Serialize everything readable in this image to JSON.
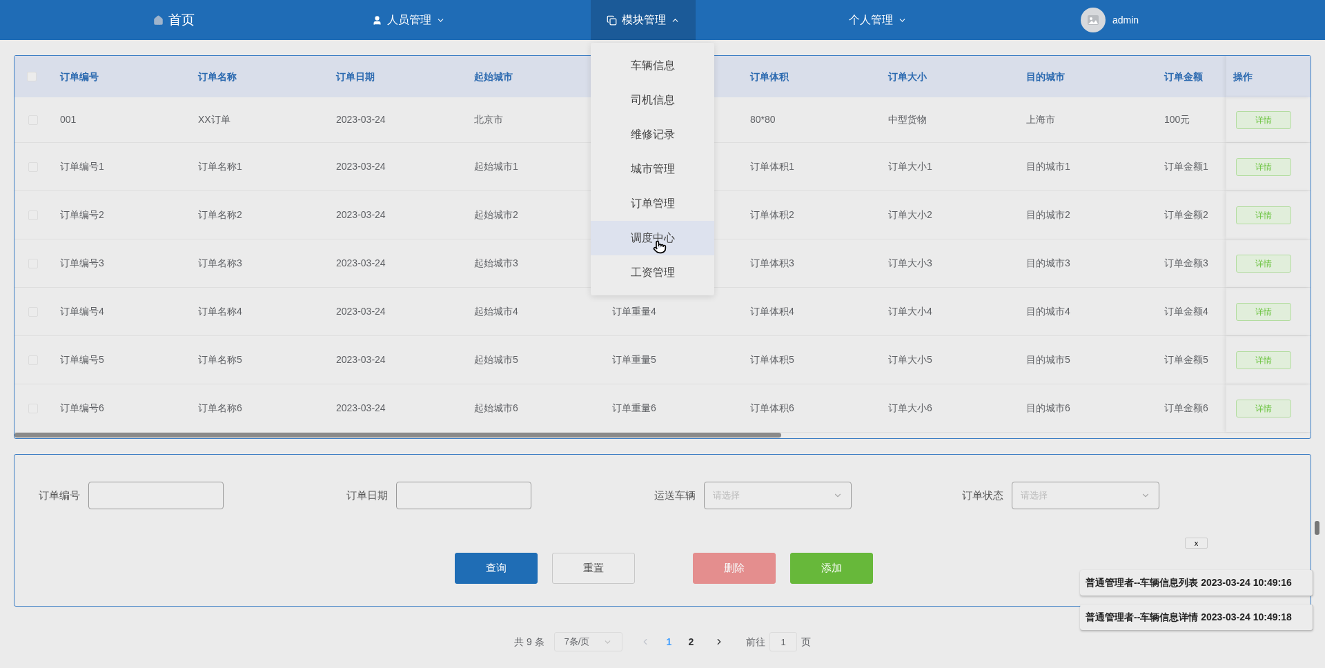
{
  "nav": {
    "items": [
      {
        "kind": "home",
        "label": "首页",
        "selected": false
      },
      {
        "kind": "people",
        "label": "人员管理",
        "expanded": false,
        "selected": false
      },
      {
        "kind": "modules",
        "label": "模块管理",
        "expanded": true,
        "selected": true,
        "menu": [
          {
            "label": "车辆信息",
            "selected": false
          },
          {
            "label": "司机信息",
            "selected": false
          },
          {
            "label": "维修记录",
            "selected": false
          },
          {
            "label": "城市管理",
            "selected": false
          },
          {
            "label": "订单管理",
            "selected": false
          },
          {
            "label": "调度中心",
            "selected": true
          },
          {
            "label": "工资管理",
            "selected": false
          }
        ]
      },
      {
        "kind": "personal",
        "label": "个人管理",
        "expanded": false,
        "selected": false
      }
    ],
    "user": {
      "name": "admin"
    }
  },
  "table": {
    "select_all_checked": false,
    "columns": [
      "订单编号",
      "订单名称",
      "订单日期",
      "起始城市",
      null,
      "订单体积",
      "订单大小",
      "目的城市",
      "订单金额"
    ],
    "action_heading": "操作",
    "rows": [
      {
        "checked": false,
        "cells": [
          "001",
          "XX订单",
          "2023-03-24",
          "北京市",
          null,
          "80*80",
          "中型货物",
          "上海市",
          "100元"
        ],
        "action": "详情"
      },
      {
        "checked": false,
        "cells": [
          "订单编号1",
          "订单名称1",
          "2023-03-24",
          "起始城市1",
          null,
          "订单体积1",
          "订单大小1",
          "目的城市1",
          "订单金额1"
        ],
        "action": "详情"
      },
      {
        "checked": false,
        "cells": [
          "订单编号2",
          "订单名称2",
          "2023-03-24",
          "起始城市2",
          null,
          "订单体积2",
          "订单大小2",
          "目的城市2",
          "订单金额2"
        ],
        "action": "详情"
      },
      {
        "checked": false,
        "cells": [
          "订单编号3",
          "订单名称3",
          "2023-03-24",
          "起始城市3",
          null,
          "订单体积3",
          "订单大小3",
          "目的城市3",
          "订单金额3"
        ],
        "action": "详情"
      },
      {
        "checked": false,
        "cells": [
          "订单编号4",
          "订单名称4",
          "2023-03-24",
          "起始城市4",
          "订单重量4",
          "订单体积4",
          "订单大小4",
          "目的城市4",
          "订单金额4"
        ],
        "action": "详情"
      },
      {
        "checked": false,
        "cells": [
          "订单编号5",
          "订单名称5",
          "2023-03-24",
          "起始城市5",
          "订单重量5",
          "订单体积5",
          "订单大小5",
          "目的城市5",
          "订单金额5"
        ],
        "action": "详情"
      },
      {
        "checked": false,
        "cells": [
          "订单编号6",
          "订单名称6",
          "2023-03-24",
          "起始城市6",
          "订单重量6",
          "订单体积6",
          "订单大小6",
          "目的城市6",
          "订单金额6"
        ],
        "action": "详情"
      }
    ]
  },
  "search_form": {
    "fields": [
      {
        "kind": "text",
        "label": "订单编号"
      },
      {
        "kind": "text",
        "label": "订单日期"
      },
      {
        "kind": "select",
        "label": "运送车辆",
        "placeholder": "请选择"
      },
      {
        "kind": "select",
        "label": "订单状态",
        "placeholder": "请选择"
      }
    ],
    "buttons": [
      {
        "kind": "primary",
        "label": "查询",
        "disabled": false
      },
      {
        "kind": "default",
        "label": "重置",
        "disabled": false
      },
      {
        "kind": "danger",
        "label": "删除",
        "disabled": true
      },
      {
        "kind": "success",
        "label": "添加",
        "disabled": false
      }
    ]
  },
  "pagination": {
    "total": "共 9 条",
    "page_size": "7条/页",
    "pages": [
      {
        "label": "1",
        "selected": true
      },
      {
        "label": "2",
        "selected": false
      }
    ],
    "goto_label": "前往",
    "goto_value": "1",
    "goto_suffix": "页"
  },
  "notifications": {
    "close": "x",
    "items": [
      {
        "text": "普通管理者--车辆信息列表 2023-03-24 10:49:16"
      },
      {
        "text": "普通管理者--车辆信息详情 2023-03-24 10:49:18"
      }
    ]
  }
}
